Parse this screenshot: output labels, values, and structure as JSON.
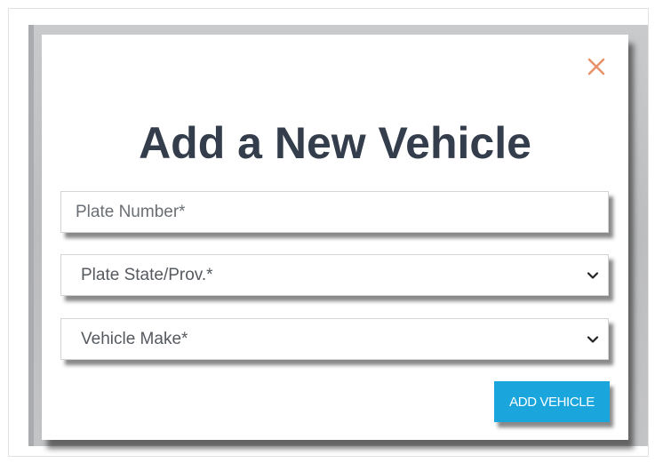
{
  "modal": {
    "title": "Add a New Vehicle",
    "close_icon": "close-icon",
    "fields": {
      "plate_number": {
        "placeholder": "Plate Number*",
        "value": ""
      },
      "plate_state": {
        "selected": "Plate State/Prov.*",
        "icon": "chevron-down-icon"
      },
      "vehicle_make": {
        "selected": "Vehicle Make*",
        "icon": "chevron-down-icon"
      }
    },
    "submit_label": "ADD VEHICLE"
  },
  "colors": {
    "title": "#333d4c",
    "close_icon": "#e8926a",
    "button": "#1aa6dc",
    "button_text": "#ffffff",
    "backdrop": "#c4c5c7"
  }
}
